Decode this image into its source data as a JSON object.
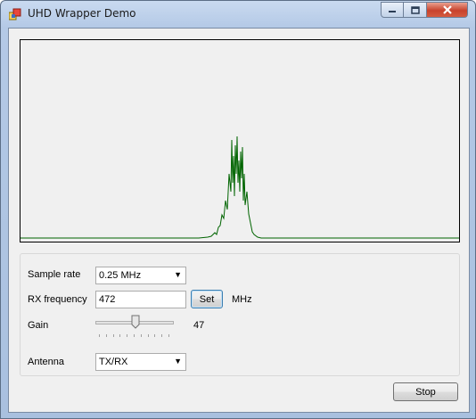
{
  "window": {
    "title": "UHD Wrapper Demo"
  },
  "controls": {
    "sample_rate": {
      "label": "Sample rate",
      "value": "0.25 MHz"
    },
    "rx_frequency": {
      "label": "RX frequency",
      "value": "472",
      "set_label": "Set",
      "unit": "MHz"
    },
    "gain": {
      "label": "Gain",
      "value": "47",
      "level_fraction": 0.52
    },
    "antenna": {
      "label": "Antenna",
      "value": "TX/RX"
    }
  },
  "stop_button": {
    "label": "Stop"
  },
  "colors": {
    "trace": "#006400",
    "frame": "#000000"
  }
}
